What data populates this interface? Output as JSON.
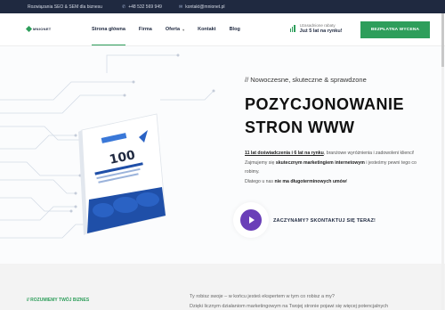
{
  "topbar": {
    "tagline": "Rozwiązania SEO & SEM dla biznesu",
    "phone": "+48 532 569 949",
    "email": "kontakt@mnionet.pl"
  },
  "header": {
    "logo_text": "MNIONET",
    "nav": [
      {
        "label": "Strona główna",
        "active": true
      },
      {
        "label": "Firma",
        "active": false
      },
      {
        "label": "Oferta",
        "active": false,
        "dropdown": true
      },
      {
        "label": "Kontakt",
        "active": false
      },
      {
        "label": "Blog",
        "active": false
      }
    ],
    "badge_line1": "Uzasadnione rabaty",
    "badge_line2": "Już 5 lat na rynku!",
    "cta_label": "BEZPŁATNA WYCENA"
  },
  "hero": {
    "eyebrow": "// Nowoczesne, skuteczne & sprawdzone",
    "title_line1": "POZYCJONOWANIE",
    "title_line2": "STRON WWW",
    "para_lead": "11 lat doświadczenia i 6 lat na rynku",
    "para_rest": ", branżowe wyróżnienia i zadowoleni klienci!",
    "para2_a": "Zajmujemy się ",
    "para2_b": "skutecznym marketingiem internetowym",
    "para2_c": " i jesteśmy pewni tego co robimy.",
    "para3_a": "Dlatego u nas ",
    "para3_b": "nie ma długoterminowych umów",
    "para3_c": "!",
    "cta_text": "ZACZYNAMY? SKONTAKTUJ SIĘ TERAZ!",
    "book_text": "100"
  },
  "lower": {
    "label": "// ROZUMIEMY TWÓJ BIZNES",
    "text1": "Ty robisz swoje – w końcu jesteś ekspertem w tym co robisz a my?",
    "text2": "Dzięki licznym działaniom marketingowym na Twojej stronie pojawi się więcej potencjalnych"
  },
  "colors": {
    "accent": "#2e9e5b",
    "dark": "#1f2940",
    "play": "#6a3fb8"
  }
}
